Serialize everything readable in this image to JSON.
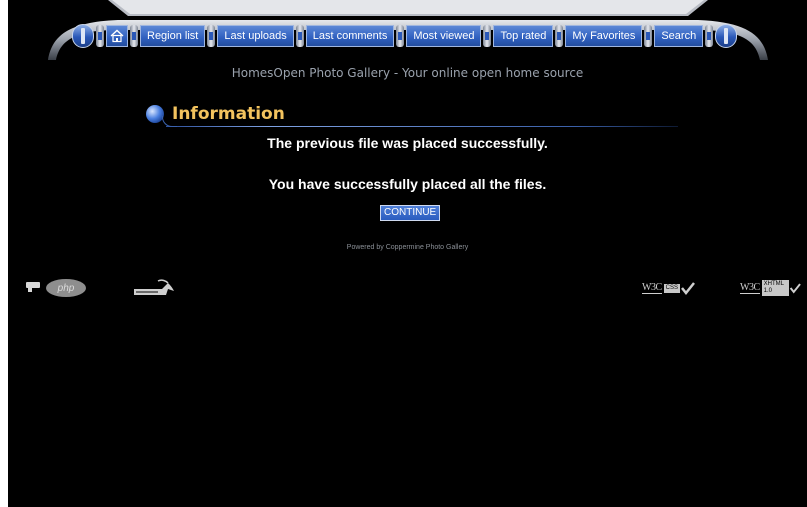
{
  "nav": {
    "home_icon": "home-icon",
    "items": [
      {
        "label": "Region list"
      },
      {
        "label": "Last uploads"
      },
      {
        "label": "Last comments"
      },
      {
        "label": "Most viewed"
      },
      {
        "label": "Top rated"
      },
      {
        "label": "My Favorites"
      },
      {
        "label": "Search"
      }
    ]
  },
  "header": {
    "tagline": "HomesOpen Photo Gallery - Your online open home source"
  },
  "info": {
    "title": "Information",
    "message_1": "The previous file was placed successfully.",
    "message_2": "You have successfully placed all the files.",
    "continue_label": "CONTINUE"
  },
  "footer": {
    "powered_by": "Powered by Coppermine Photo Gallery",
    "badges": {
      "php": "php",
      "css_w3c": "W3C",
      "css_tag": "CSS",
      "xhtml_w3c": "W3C",
      "xhtml_tag": "XHTML 1.0"
    }
  },
  "colors": {
    "background": "#000000",
    "nav_button": "#2f5fbf",
    "title_accent": "#f3c35e",
    "tagline": "#9aa2ad"
  }
}
